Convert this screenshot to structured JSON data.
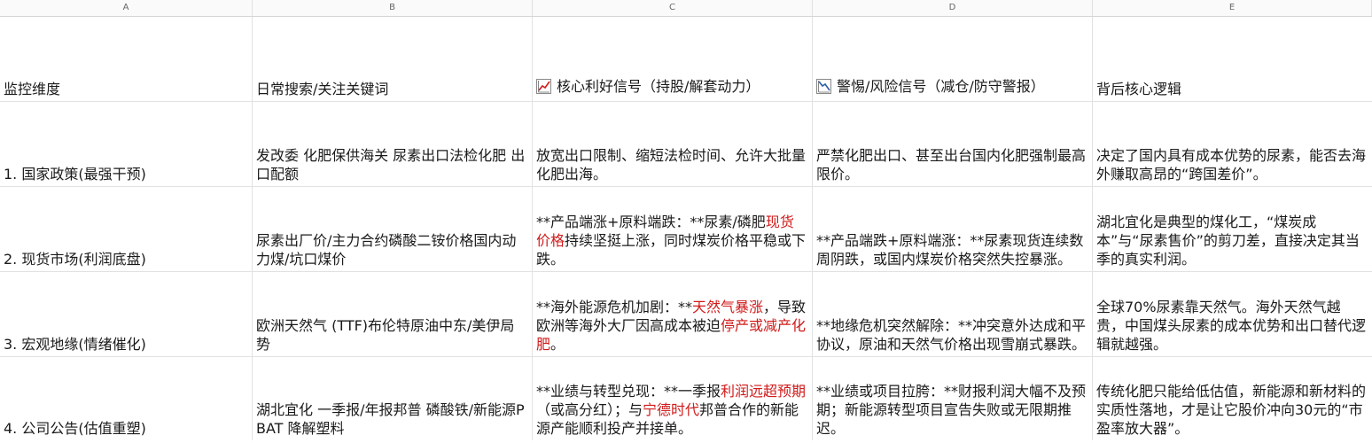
{
  "columns": [
    "A",
    "B",
    "C",
    "D",
    "E"
  ],
  "header": {
    "a": "监控维度",
    "b": "日常搜索/关注关键词",
    "c": "核心利好信号（持股/解套动力）",
    "c_icon": "chart-increasing-icon",
    "d": "警惕/风险信号（减仓/防守警报）",
    "d_icon": "chart-decreasing-icon",
    "e": "背后核心逻辑"
  },
  "rows": [
    {
      "a": "1. 国家政策(最强干预)",
      "b": "发改委 化肥保供海关 尿素出口法检化肥 出口配额",
      "c": [
        {
          "t": "放宽出口限制、缩短法检时间、允许大批量化肥出海。"
        }
      ],
      "d": "严禁化肥出口、甚至出台国内化肥强制最高限价。",
      "e": "决定了国内具有成本优势的尿素，能否去海外赚取高昂的“跨国差价”。"
    },
    {
      "a": "2. 现货市场(利润底盘)",
      "b": "尿素出厂价/主力合约磷酸二铵价格国内动力煤/坑口煤价",
      "c": [
        {
          "t": "**产品端涨+原料端跌：**尿素/磷肥"
        },
        {
          "t": "现货价格",
          "red": true
        },
        {
          "t": "持续坚挺上涨，同时煤炭价格平稳或下跌。"
        }
      ],
      "d": "**产品端跌+原料端涨：**尿素现货连续数周阴跌，或国内煤炭价格突然失控暴涨。",
      "e": "湖北宜化是典型的煤化工，“煤炭成本”与“尿素售价”的剪刀差，直接决定其当季的真实利润。"
    },
    {
      "a": "3. 宏观地缘(情绪催化)",
      "b": "欧洲天然气 (TTF)布伦特原油中东/美伊局势",
      "c": [
        {
          "t": "**海外能源危机加剧：**"
        },
        {
          "t": "天然气暴涨",
          "red": true
        },
        {
          "t": "，导致欧洲等海外大厂因高成本被迫"
        },
        {
          "t": "停产或减产化肥",
          "red": true
        },
        {
          "t": "。"
        }
      ],
      "d": "**地缘危机突然解除：**冲突意外达成和平协议，原油和天然气价格出现雪崩式暴跌。",
      "e": "全球70%尿素靠天然气。海外天然气越贵，中国煤头尿素的成本优势和出口替代逻辑就越强。"
    },
    {
      "a": "4. 公司公告(估值重塑)",
      "b": "湖北宜化 一季报/年报邦普 磷酸铁/新能源PBAT 降解塑料",
      "c": [
        {
          "t": "**业绩与转型兑现：**一季报"
        },
        {
          "t": "利润远超预期",
          "red": true
        },
        {
          "t": "（或高分红）；与"
        },
        {
          "t": "宁德时代",
          "red": true
        },
        {
          "t": "邦普合作的新能源产能顺利投产并接单。"
        }
      ],
      "d": "**业绩或项目拉胯：**财报利润大幅不及预期；新能源转型项目宣告失败或无限期推迟。",
      "e": "传统化肥只能给低估值，新能源和新材料的实质性落地，才是让它股价冲向30元的“市盈率放大器”。"
    }
  ]
}
